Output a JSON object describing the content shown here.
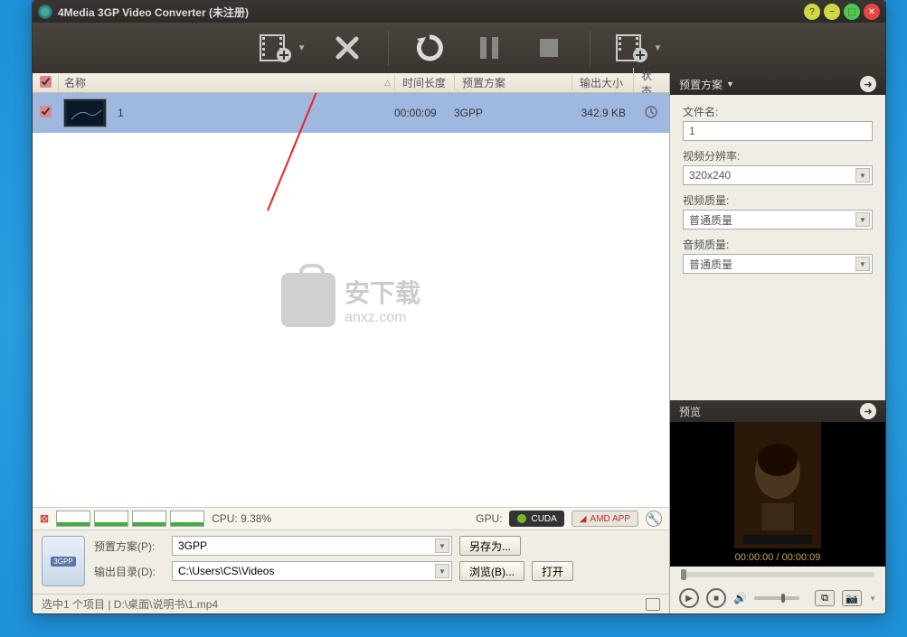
{
  "titlebar": {
    "title": "4Media 3GP Video Converter (未注册)"
  },
  "grid": {
    "headers": {
      "name": "名称",
      "time": "时间长度",
      "preset": "预置方案",
      "size": "输出大小",
      "status": "状态"
    },
    "row": {
      "name": "1",
      "time": "00:00:09",
      "preset": "3GPP",
      "size": "342.9 KB"
    }
  },
  "watermark": {
    "text": "安下载",
    "sub": "anxz.com"
  },
  "perf": {
    "cpu_label": "CPU: 9.38%",
    "gpu_label": "GPU:",
    "cuda": "CUDA",
    "amd": "AMD APP"
  },
  "bottom": {
    "preset_label": "预置方案(P):",
    "preset_value": "3GPP",
    "saveas": "另存为...",
    "output_label": "输出目录(D):",
    "output_value": "C:\\Users\\CS\\Videos",
    "browse": "浏览(B)...",
    "open": "打开",
    "file_badge": "3GPP"
  },
  "statusbar": {
    "text": "选中1 个项目 | D:\\桌面\\说明书\\1.mp4"
  },
  "right": {
    "preset_hdr": "预置方案",
    "preview_hdr": "预览",
    "filename_label": "文件名:",
    "filename_value": "1",
    "resolution_label": "视频分辨率:",
    "resolution_value": "320x240",
    "vquality_label": "视频质量:",
    "vquality_value": "普通质量",
    "aquality_label": "音频质量:",
    "aquality_value": "普通质量"
  },
  "preview": {
    "time": "00:00:00 / 00:00:09"
  }
}
